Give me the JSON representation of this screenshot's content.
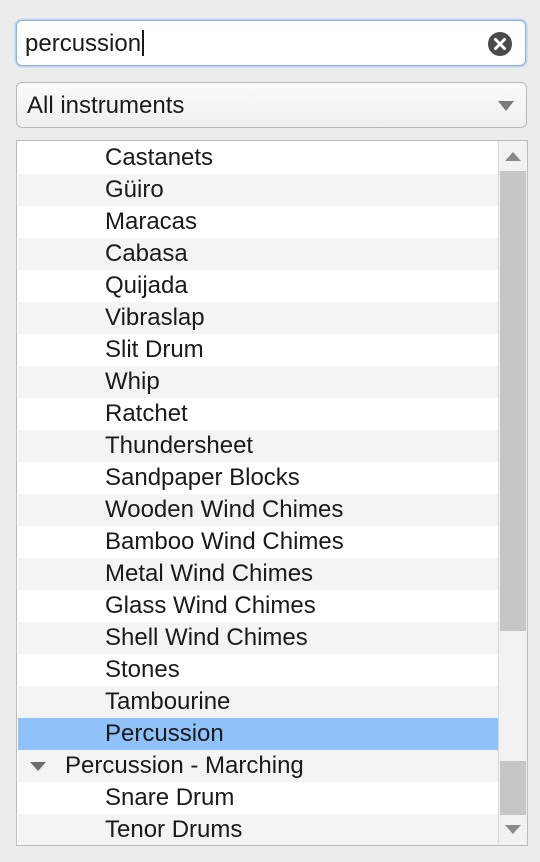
{
  "search": {
    "value": "percussion",
    "clear_icon": "clear-circle-x-icon"
  },
  "filter": {
    "selected": "All instruments"
  },
  "list": {
    "items": [
      {
        "label": "Castanets",
        "level": 1
      },
      {
        "label": "Güiro",
        "level": 1
      },
      {
        "label": "Maracas",
        "level": 1
      },
      {
        "label": "Cabasa",
        "level": 1
      },
      {
        "label": "Quijada",
        "level": 1
      },
      {
        "label": "Vibraslap",
        "level": 1
      },
      {
        "label": "Slit Drum",
        "level": 1
      },
      {
        "label": "Whip",
        "level": 1
      },
      {
        "label": "Ratchet",
        "level": 1
      },
      {
        "label": "Thundersheet",
        "level": 1
      },
      {
        "label": "Sandpaper Blocks",
        "level": 1
      },
      {
        "label": "Wooden Wind Chimes",
        "level": 1
      },
      {
        "label": "Bamboo Wind Chimes",
        "level": 1
      },
      {
        "label": "Metal Wind Chimes",
        "level": 1
      },
      {
        "label": "Glass Wind Chimes",
        "level": 1
      },
      {
        "label": "Shell Wind Chimes",
        "level": 1
      },
      {
        "label": "Stones",
        "level": 1
      },
      {
        "label": "Tambourine",
        "level": 1
      },
      {
        "label": "Percussion",
        "level": 1,
        "selected": true
      },
      {
        "label": "Percussion - Marching",
        "level": 0,
        "expanded": true
      },
      {
        "label": "Snare Drum",
        "level": 1
      },
      {
        "label": "Tenor Drums",
        "level": 1
      }
    ]
  },
  "colors": {
    "selection": "#8ec2f8",
    "focus_ring": "#8fb2e0"
  }
}
